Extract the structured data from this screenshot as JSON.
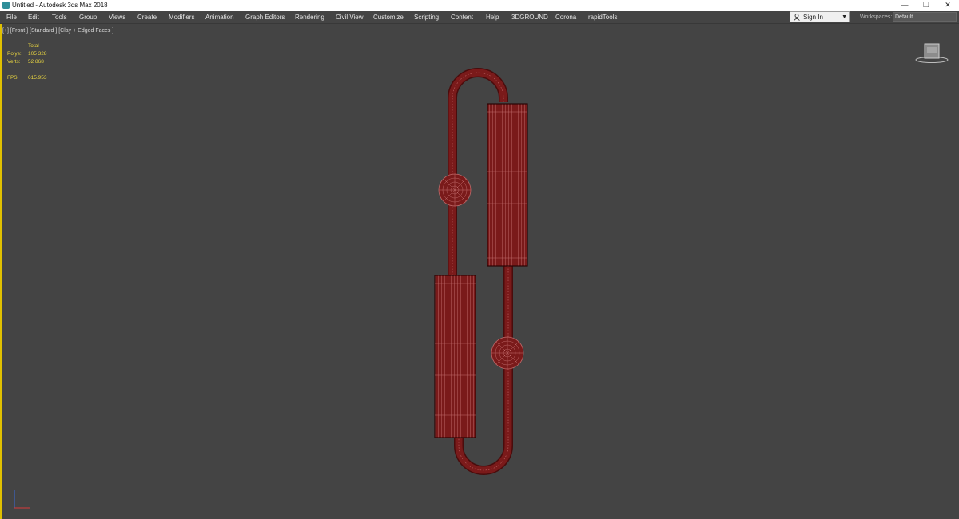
{
  "window": {
    "title": "Untitled - Autodesk 3ds Max 2018",
    "controls": [
      "—",
      "❐",
      "✕"
    ]
  },
  "menu": [
    "File",
    "Edit",
    "Tools",
    "Group",
    "Views",
    "Create",
    "Modifiers",
    "Animation",
    "Graph Editors",
    "Rendering",
    "Civil View",
    "Customize",
    "Scripting",
    "Content",
    "Help",
    "3DGROUND",
    "Corona",
    "rapidTools"
  ],
  "signin": {
    "label": "Sign In"
  },
  "workspaces": {
    "label": "Workspaces:",
    "value": "Default"
  },
  "viewport": {
    "label": "[+] [Front ] [Standard ] [Clay + Edged Faces ]",
    "stats": {
      "total_label": "Total",
      "polys_label": "Polys:",
      "polys_value": "105 328",
      "verts_label": "Verts:",
      "verts_value": "52 868",
      "fps_label": "FPS:",
      "fps_value": "615.953"
    }
  },
  "colors": {
    "viewport_bg": "#444444",
    "model_fill": "#7a1a1a",
    "model_wire": "#c06a6a",
    "active_border": "#e0c000",
    "stats_text": "#e8d440"
  }
}
